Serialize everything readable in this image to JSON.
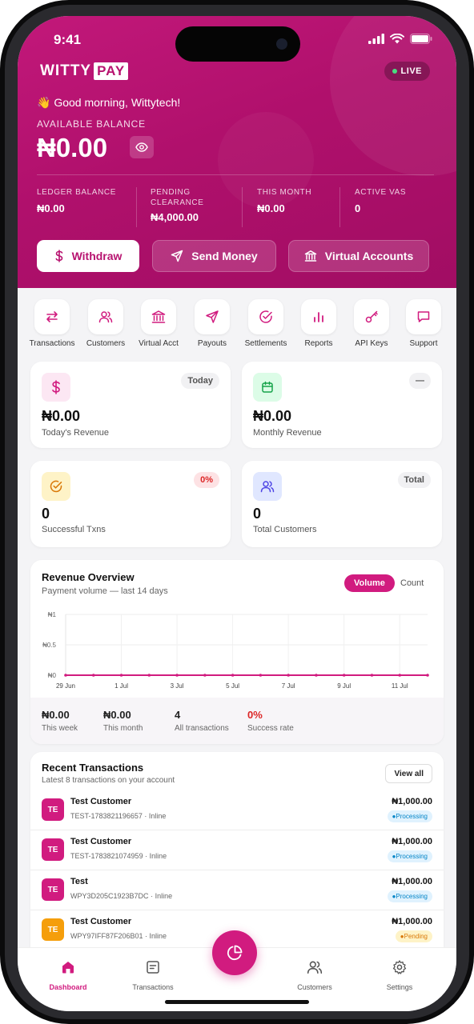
{
  "status_bar": {
    "time": "9:41"
  },
  "brand": {
    "name_part1": "WITTY",
    "name_part2": "PAY"
  },
  "mode_badge": "LIVE",
  "greeting": "👋 Good morning, Wittytech!",
  "balance": {
    "label": "AVAILABLE BALANCE",
    "amount": "₦0.00"
  },
  "stats": [
    {
      "label": "LEDGER BALANCE",
      "value": "₦0.00"
    },
    {
      "label": "PENDING CLEARANCE",
      "value": "₦4,000.00"
    },
    {
      "label": "THIS MONTH",
      "value": "₦0.00"
    },
    {
      "label": "ACTIVE VAS",
      "value": "0"
    }
  ],
  "actions": {
    "withdraw": "Withdraw",
    "send_money": "Send Money",
    "virtual_accounts": "Virtual Accounts"
  },
  "quick_actions": [
    {
      "label": "Transactions",
      "icon": "swap-icon"
    },
    {
      "label": "Customers",
      "icon": "users-icon"
    },
    {
      "label": "Virtual Acct",
      "icon": "bank-icon"
    },
    {
      "label": "Payouts",
      "icon": "send-icon"
    },
    {
      "label": "Settlements",
      "icon": "check-circle-icon"
    },
    {
      "label": "Reports",
      "icon": "bar-chart-icon"
    },
    {
      "label": "API Keys",
      "icon": "key-icon"
    },
    {
      "label": "Support",
      "icon": "chat-icon"
    }
  ],
  "kpis": [
    {
      "value": "₦0.00",
      "label": "Today's Revenue",
      "tag": "Today"
    },
    {
      "value": "₦0.00",
      "label": "Monthly Revenue",
      "tag": "—"
    },
    {
      "value": "0",
      "label": "Successful Txns",
      "tag": "0%"
    },
    {
      "value": "0",
      "label": "Total Customers",
      "tag": "Total"
    }
  ],
  "revenue_overview": {
    "title": "Revenue Overview",
    "subtitle": "Payment volume — last 14 days",
    "toggle": [
      "Volume",
      "Count"
    ],
    "summary": [
      {
        "value": "₦0.00",
        "label": "This week"
      },
      {
        "value": "₦0.00",
        "label": "This month"
      },
      {
        "value": "4",
        "label": "All transactions"
      },
      {
        "value": "0%",
        "label": "Success rate"
      }
    ]
  },
  "chart_data": {
    "type": "line",
    "x": [
      "29 Jun",
      "30 Jun",
      "1 Jul",
      "2 Jul",
      "3 Jul",
      "4 Jul",
      "5 Jul",
      "6 Jul",
      "7 Jul",
      "8 Jul",
      "9 Jul",
      "10 Jul",
      "11 Jul",
      "12 Jul"
    ],
    "x_tick_labels": [
      "29 Jun",
      "1 Jul",
      "3 Jul",
      "5 Jul",
      "7 Jul",
      "9 Jul",
      "11 Jul"
    ],
    "y_tick_labels": [
      "₦1",
      "₦0.5",
      "₦0"
    ],
    "series": [
      {
        "values": [
          0,
          0,
          0,
          0,
          0,
          0,
          0,
          0,
          0,
          0,
          0,
          0,
          0,
          0
        ]
      }
    ],
    "ylim": [
      0,
      1
    ],
    "grid": true,
    "line_color": "#d11b7f"
  },
  "recent_transactions": {
    "title": "Recent Transactions",
    "subtitle": "Latest 8 transactions on your account",
    "view_all": "View all",
    "items": [
      {
        "initials": "TE",
        "name": "Test Customer",
        "ref": "TEST-1783821196657",
        "channel": "Inline",
        "amount": "₦1,000.00",
        "status": "Processing",
        "avatar_color": "#d11b7f"
      },
      {
        "initials": "TE",
        "name": "Test Customer",
        "ref": "TEST-1783821074959",
        "channel": "Inline",
        "amount": "₦1,000.00",
        "status": "Processing",
        "avatar_color": "#d11b7f"
      },
      {
        "initials": "TE",
        "name": "Test",
        "ref": "WPY3D205C1923B7DC",
        "channel": "Inline",
        "amount": "₦1,000.00",
        "status": "Processing",
        "avatar_color": "#d11b7f"
      },
      {
        "initials": "TE",
        "name": "Test Customer",
        "ref": "WPY97IFF87F206B01",
        "channel": "Inline",
        "amount": "₦1,000.00",
        "status": "Pending",
        "avatar_color": "#f59e0b"
      }
    ]
  },
  "bottom_nav": [
    {
      "label": "Dashboard",
      "icon": "home-icon",
      "active": true
    },
    {
      "label": "Transactions",
      "icon": "receipt-icon",
      "active": false
    },
    {
      "label": "",
      "icon": "pie-chart-icon",
      "active": false
    },
    {
      "label": "Customers",
      "icon": "users-icon",
      "active": false
    },
    {
      "label": "Settings",
      "icon": "gear-icon",
      "active": false
    }
  ],
  "colors": {
    "brand": "#c2187a",
    "accent": "#d11b7f",
    "processing_bg": "#e0f2fe",
    "processing_text": "#0284c7",
    "pending_bg": "#fef3c7",
    "pending_text": "#d97706"
  }
}
